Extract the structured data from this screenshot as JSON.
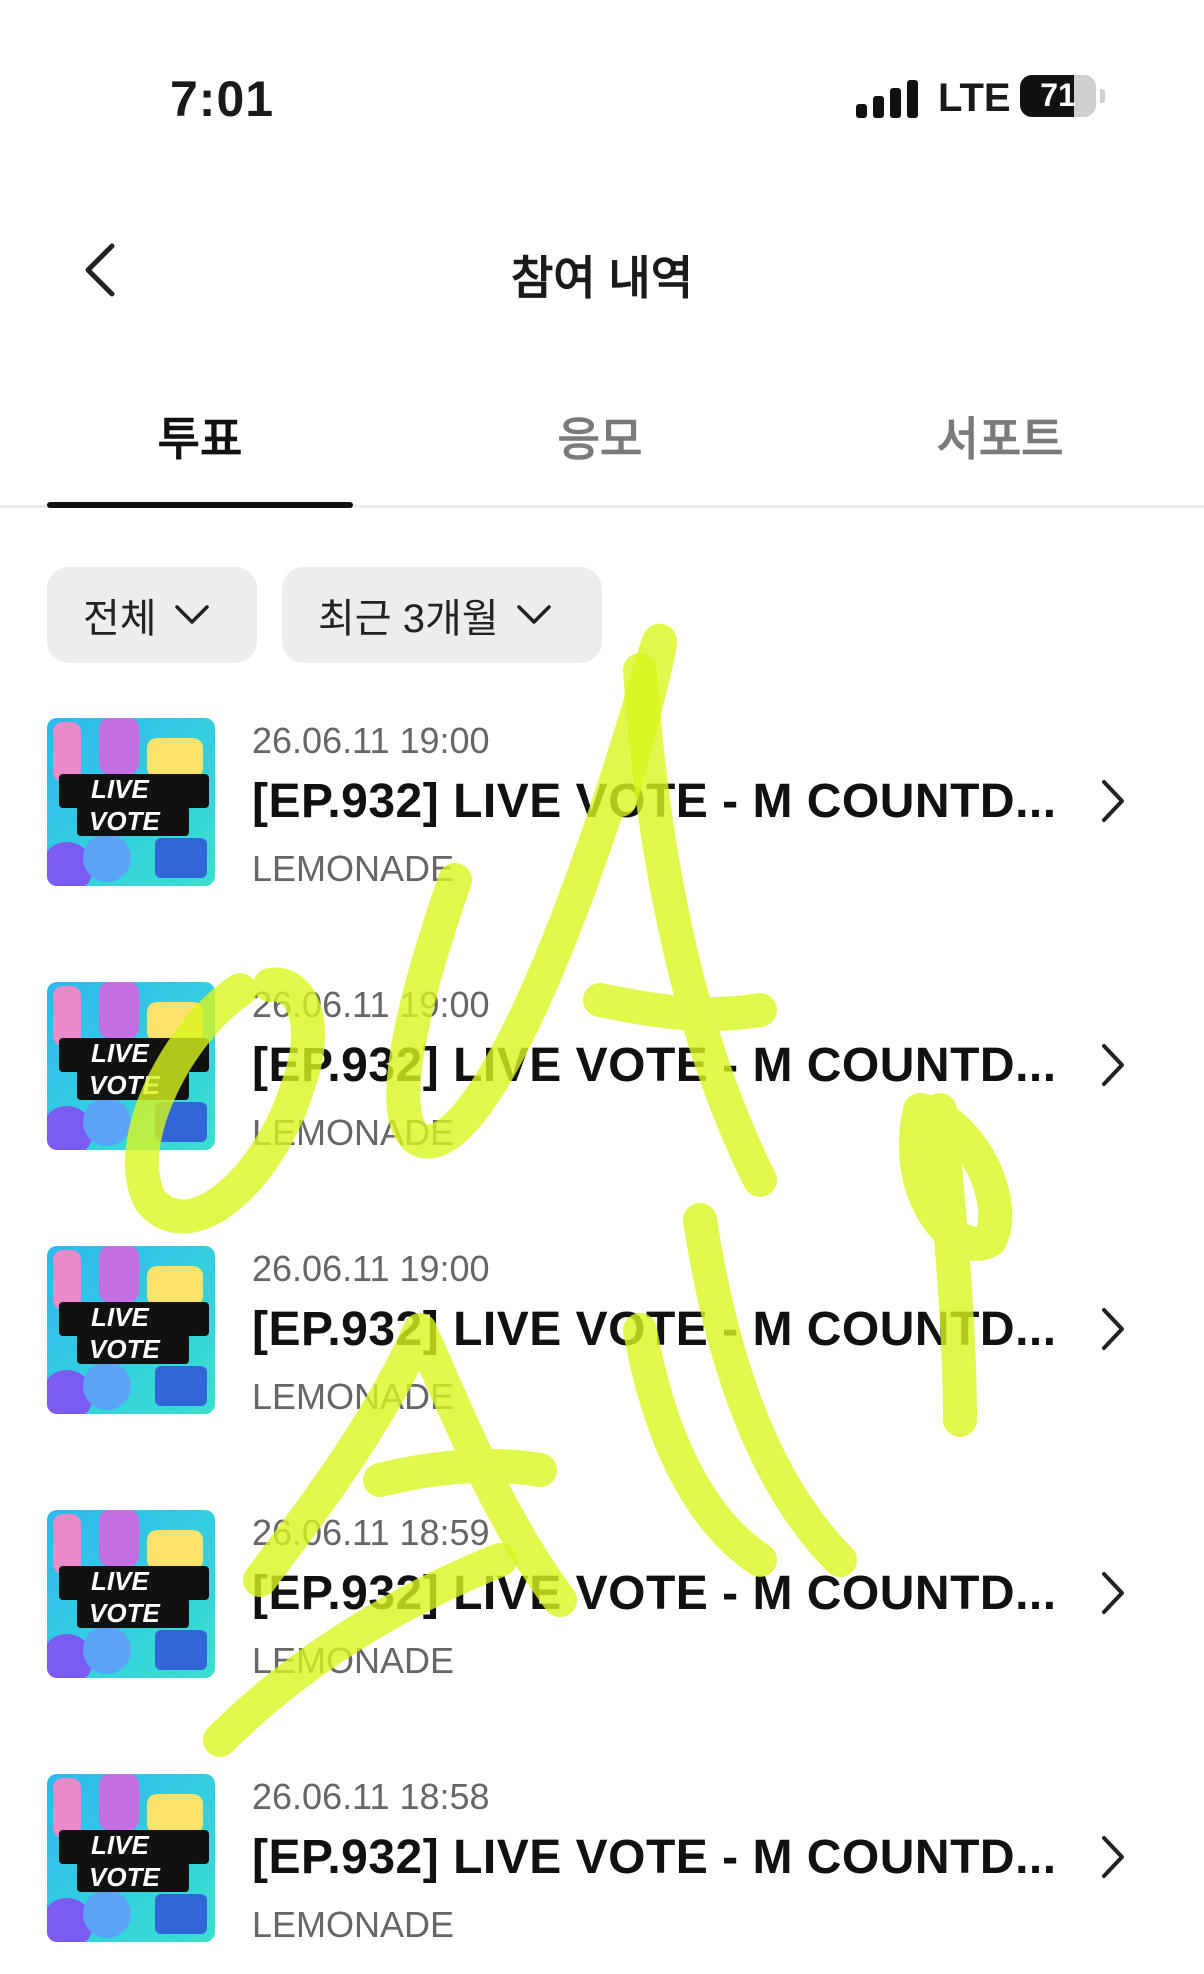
{
  "status_bar": {
    "time": "7:01",
    "network": "LTE",
    "battery": "71",
    "battery_level": 0.71
  },
  "header": {
    "title": "참여 내역",
    "back_icon": "chevron-left-icon"
  },
  "tabs": [
    {
      "label": "투표",
      "active": true
    },
    {
      "label": "응모",
      "active": false
    },
    {
      "label": "서포트",
      "active": false
    }
  ],
  "filters": [
    {
      "label": "전체"
    },
    {
      "label": "최근 3개월"
    }
  ],
  "thumbnail": {
    "line1": "LIVE",
    "line2": "VOTE"
  },
  "items": [
    {
      "date": "26.06.11 19:00",
      "title": "[EP.932] LIVE VOTE - M COUNTD...",
      "artist": "LEMONADE"
    },
    {
      "date": "26.06.11 19:00",
      "title": "[EP.932] LIVE VOTE - M COUNTD...",
      "artist": "LEMONADE"
    },
    {
      "date": "26.06.11 19:00",
      "title": "[EP.932] LIVE VOTE - M COUNTD...",
      "artist": "LEMONADE"
    },
    {
      "date": "26.06.11 18:59",
      "title": "[EP.932] LIVE VOTE - M COUNTD...",
      "artist": "LEMONADE"
    },
    {
      "date": "26.06.11 18:58",
      "title": "[EP.932] LIVE VOTE - M COUNTD...",
      "artist": "LEMONADE"
    }
  ],
  "colors": {
    "accent": "#111111",
    "chip_bg": "#ededf0",
    "highlighter": "#d8f51e"
  }
}
